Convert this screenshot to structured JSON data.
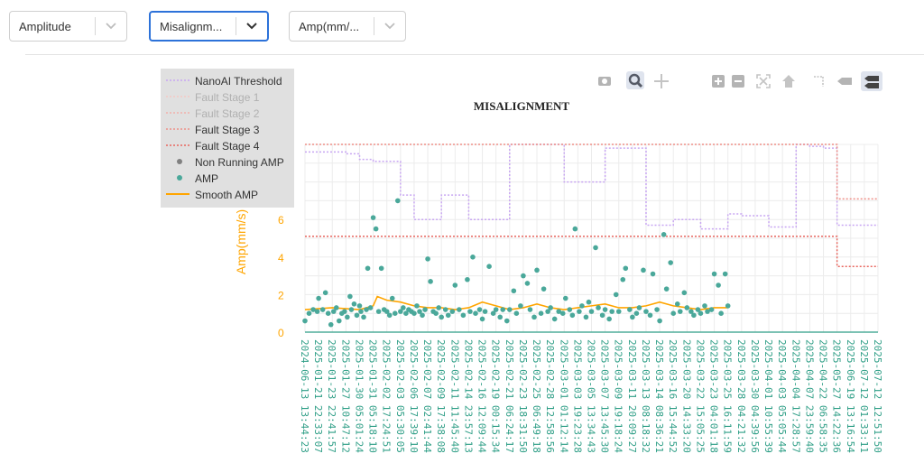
{
  "filters": {
    "metric": "Amplitude",
    "fault_type": "Misalignm...",
    "unit": "Amp(mm/..."
  },
  "colors": {
    "threshold": "#c8a6f2",
    "fault1": "#f6c7c4",
    "fault2": "#f3b0aa",
    "fault3": "#ee8f87",
    "fault4": "#e8665e",
    "non_running": "#808080",
    "amp": "#4aa89a",
    "smooth": "#ffa500",
    "axis_text": "#2e9e86",
    "ylabel": "#ffa500"
  },
  "modebar": [
    "camera-icon",
    "zoom-icon",
    "pan-icon",
    "zoom-in-icon",
    "zoom-out-icon",
    "autoscale-icon",
    "reset-axes-icon",
    "spike-lines-icon",
    "hover-closest-icon",
    "hover-compare-icon"
  ],
  "chart_data": {
    "type": "scatter",
    "title": "MISALIGNMENT",
    "ylabel": "Amp(mm/s)",
    "xlabel": "",
    "ylim": [
      0,
      10
    ],
    "yticks": [
      0,
      2,
      4,
      6
    ],
    "grid": true,
    "legend_position": "top-left",
    "x_categories": [
      "2024-06-13 13:44:23",
      "2025-01-21 22:33:07",
      "2025-01-23 22:41:57",
      "2025-01-27 10:47:12",
      "2025-01-30 05:01:24",
      "2025-01-31 05:18:10",
      "2025-02-02 17:24:51",
      "2025-02-03 05:30:05",
      "2025-02-06 17:39:10",
      "2025-02-07 02:41:44",
      "2025-02-09 17:38:08",
      "2025-02-11 11:45:40",
      "2025-02-14 23:57:13",
      "2025-02-16 12:09:44",
      "2025-02-19 00:15:34",
      "2025-02-21 06:24:17",
      "2025-02-23 18:31:50",
      "2025-02-25 06:49:18",
      "2025-02-28 12:58:56",
      "2025-03-01 01:12:14",
      "2025-03-03 19:23:28",
      "2025-03-05 13:34:43",
      "2025-03-07 13:45:30",
      "2025-03-09 19:18:24",
      "2025-03-11 20:09:27",
      "2025-03-13 08:18:32",
      "2025-03-14 08:36:21",
      "2025-03-16 15:44:52",
      "2025-03-20 14:33:20",
      "2025-03-22 15:05:25",
      "2025-03-23 04:01:18",
      "2025-03-25 16:11:59",
      "2025-03-28 04:21:32",
      "2025-03-30 04:39:56",
      "2025-04-01 10:55:39",
      "2025-04-03 05:05:44",
      "2025-04-04 17:28:57",
      "2025-04-07 23:59:40",
      "2025-04-22 06:58:35",
      "2025-05-27 14:22:36",
      "2025-06-19 13:16:54",
      "2025-07-12 01:33:11",
      "2025-07-12 12:51:50"
    ],
    "series": [
      {
        "name": "NanoAI Threshold",
        "style": "dotted-line",
        "values": [
          9.6,
          9.6,
          9.6,
          9.5,
          9.2,
          9.1,
          9.1,
          7.3,
          6.0,
          6.0,
          7.3,
          7.3,
          6.0,
          6.0,
          6.0,
          10.0,
          10.0,
          10.0,
          10.0,
          8.0,
          8.0,
          8.0,
          9.8,
          9.8,
          9.8,
          5.7,
          5.7,
          6.0,
          6.0,
          5.5,
          5.5,
          6.3,
          6.2,
          6.2,
          5.6,
          5.6,
          10.0,
          9.9,
          9.8,
          5.7,
          5.7,
          5.7,
          5.7
        ]
      },
      {
        "name": "Fault Stage 1",
        "style": "dotted-line",
        "values": []
      },
      {
        "name": "Fault Stage 2",
        "style": "dotted-line",
        "values": []
      },
      {
        "name": "Fault Stage 3",
        "style": "dotted-line",
        "values": [
          10.0,
          10.0,
          10.0,
          10.0,
          10.0,
          10.0,
          10.0,
          10.0,
          10.0,
          10.0,
          10.0,
          10.0,
          10.0,
          10.0,
          10.0,
          10.0,
          10.0,
          10.0,
          10.0,
          10.0,
          10.0,
          10.0,
          10.0,
          10.0,
          10.0,
          10.0,
          10.0,
          10.0,
          10.0,
          10.0,
          10.0,
          10.0,
          10.0,
          10.0,
          10.0,
          10.0,
          10.0,
          10.0,
          10.0,
          7.1,
          7.1,
          7.1,
          7.1
        ]
      },
      {
        "name": "Fault Stage 4",
        "style": "dotted-line",
        "values": [
          5.1,
          5.1,
          5.1,
          5.1,
          5.1,
          5.1,
          5.1,
          5.1,
          5.1,
          5.1,
          5.1,
          5.1,
          5.1,
          5.1,
          5.1,
          5.1,
          5.1,
          5.1,
          5.1,
          5.1,
          5.1,
          5.1,
          5.1,
          5.1,
          5.1,
          5.1,
          5.1,
          5.1,
          5.1,
          5.1,
          5.1,
          5.1,
          5.1,
          5.1,
          5.1,
          5.1,
          5.1,
          5.1,
          5.1,
          3.5,
          3.5,
          3.5,
          3.5
        ]
      },
      {
        "name": "Non Running AMP",
        "style": "markers",
        "points": []
      },
      {
        "name": "AMP",
        "style": "markers",
        "points": [
          [
            0.0,
            0.6
          ],
          [
            0.3,
            1.0
          ],
          [
            0.6,
            1.2
          ],
          [
            0.9,
            1.1
          ],
          [
            1.0,
            1.8
          ],
          [
            1.3,
            1.2
          ],
          [
            1.5,
            2.1
          ],
          [
            1.7,
            1.0
          ],
          [
            1.9,
            0.4
          ],
          [
            2.1,
            1.1
          ],
          [
            2.3,
            1.3
          ],
          [
            2.5,
            0.6
          ],
          [
            2.7,
            1.0
          ],
          [
            2.9,
            1.1
          ],
          [
            3.1,
            0.8
          ],
          [
            3.3,
            1.9
          ],
          [
            3.4,
            1.2
          ],
          [
            3.6,
            1.5
          ],
          [
            3.8,
            0.9
          ],
          [
            4.0,
            1.4
          ],
          [
            4.1,
            1.1
          ],
          [
            4.3,
            0.8
          ],
          [
            4.5,
            1.2
          ],
          [
            4.6,
            3.4
          ],
          [
            4.8,
            1.3
          ],
          [
            5.0,
            6.1
          ],
          [
            5.2,
            5.5
          ],
          [
            5.4,
            1.1
          ],
          [
            5.6,
            3.4
          ],
          [
            5.8,
            1.2
          ],
          [
            6.0,
            1.1
          ],
          [
            6.2,
            0.9
          ],
          [
            6.4,
            1.8
          ],
          [
            6.6,
            1.0
          ],
          [
            6.8,
            7.0
          ],
          [
            7.0,
            1.1
          ],
          [
            7.2,
            1.3
          ],
          [
            7.4,
            1.0
          ],
          [
            7.6,
            1.2
          ],
          [
            7.8,
            1.1
          ],
          [
            8.0,
            1.0
          ],
          [
            8.2,
            1.4
          ],
          [
            8.4,
            1.1
          ],
          [
            8.6,
            0.9
          ],
          [
            8.8,
            1.2
          ],
          [
            9.0,
            3.9
          ],
          [
            9.2,
            2.7
          ],
          [
            9.4,
            1.1
          ],
          [
            9.6,
            1.0
          ],
          [
            9.8,
            1.3
          ],
          [
            10.0,
            0.8
          ],
          [
            10.3,
            1.2
          ],
          [
            10.5,
            0.9
          ],
          [
            10.8,
            1.1
          ],
          [
            11.0,
            2.5
          ],
          [
            11.3,
            1.2
          ],
          [
            11.6,
            0.9
          ],
          [
            11.9,
            2.8
          ],
          [
            12.1,
            1.1
          ],
          [
            12.3,
            4.0
          ],
          [
            12.5,
            1.0
          ],
          [
            12.8,
            1.2
          ],
          [
            13.0,
            0.7
          ],
          [
            13.2,
            1.1
          ],
          [
            13.5,
            3.5
          ],
          [
            13.8,
            1.0
          ],
          [
            14.0,
            1.2
          ],
          [
            14.3,
            0.8
          ],
          [
            14.5,
            1.2
          ],
          [
            14.8,
            0.6
          ],
          [
            15.0,
            1.2
          ],
          [
            15.3,
            2.2
          ],
          [
            15.5,
            1.0
          ],
          [
            15.8,
            1.4
          ],
          [
            16.0,
            3.0
          ],
          [
            16.3,
            2.6
          ],
          [
            16.5,
            1.2
          ],
          [
            16.8,
            0.8
          ],
          [
            17.0,
            3.3
          ],
          [
            17.3,
            1.0
          ],
          [
            17.5,
            2.3
          ],
          [
            17.8,
            1.1
          ],
          [
            18.0,
            1.3
          ],
          [
            18.3,
            0.7
          ],
          [
            18.6,
            1.1
          ],
          [
            18.9,
            1.0
          ],
          [
            19.1,
            1.8
          ],
          [
            19.4,
            1.2
          ],
          [
            19.6,
            0.9
          ],
          [
            19.8,
            5.5
          ],
          [
            20.1,
            1.1
          ],
          [
            20.3,
            1.4
          ],
          [
            20.6,
            0.8
          ],
          [
            20.8,
            1.6
          ],
          [
            21.0,
            1.1
          ],
          [
            21.3,
            4.5
          ],
          [
            21.5,
            1.3
          ],
          [
            21.8,
            0.9
          ],
          [
            22.0,
            1.2
          ],
          [
            22.3,
            0.7
          ],
          [
            22.5,
            1.1
          ],
          [
            22.8,
            2.0
          ],
          [
            23.0,
            1.1
          ],
          [
            23.3,
            2.8
          ],
          [
            23.5,
            3.4
          ],
          [
            23.8,
            1.2
          ],
          [
            24.0,
            0.8
          ],
          [
            24.3,
            1.0
          ],
          [
            24.5,
            1.3
          ],
          [
            24.8,
            3.3
          ],
          [
            25.0,
            1.1
          ],
          [
            25.3,
            0.9
          ],
          [
            25.5,
            3.1
          ],
          [
            25.8,
            1.2
          ],
          [
            26.0,
            0.6
          ],
          [
            26.3,
            5.2
          ],
          [
            26.5,
            2.3
          ],
          [
            26.8,
            3.7
          ],
          [
            27.0,
            1.0
          ],
          [
            27.3,
            1.5
          ],
          [
            27.5,
            1.1
          ],
          [
            27.8,
            2.1
          ],
          [
            28.0,
            1.3
          ],
          [
            28.3,
            1.1
          ],
          [
            28.5,
            0.9
          ],
          [
            28.8,
            1.2
          ],
          [
            29.0,
            1.0
          ],
          [
            29.3,
            1.4
          ],
          [
            29.5,
            1.1
          ],
          [
            29.8,
            1.2
          ],
          [
            30.0,
            3.1
          ],
          [
            30.3,
            2.5
          ],
          [
            30.5,
            1.0
          ],
          [
            30.8,
            3.1
          ],
          [
            31.0,
            1.4
          ]
        ]
      },
      {
        "name": "Smooth AMP",
        "style": "line",
        "points": [
          [
            0,
            1.2
          ],
          [
            2,
            1.3
          ],
          [
            4,
            1.2
          ],
          [
            5,
            1.4
          ],
          [
            5.3,
            1.9
          ],
          [
            6,
            1.7
          ],
          [
            7,
            1.6
          ],
          [
            8,
            1.4
          ],
          [
            9,
            1.3
          ],
          [
            10,
            1.3
          ],
          [
            11,
            1.2
          ],
          [
            12,
            1.3
          ],
          [
            13,
            1.6
          ],
          [
            14,
            1.4
          ],
          [
            15,
            1.2
          ],
          [
            16,
            1.3
          ],
          [
            17,
            1.5
          ],
          [
            18,
            1.3
          ],
          [
            19,
            1.2
          ],
          [
            20,
            1.3
          ],
          [
            21,
            1.4
          ],
          [
            22,
            1.5
          ],
          [
            23,
            1.3
          ],
          [
            24,
            1.3
          ],
          [
            25,
            1.4
          ],
          [
            26,
            1.6
          ],
          [
            27,
            1.4
          ],
          [
            28,
            1.3
          ],
          [
            29,
            1.2
          ],
          [
            30,
            1.3
          ],
          [
            31,
            1.3
          ]
        ]
      }
    ]
  }
}
